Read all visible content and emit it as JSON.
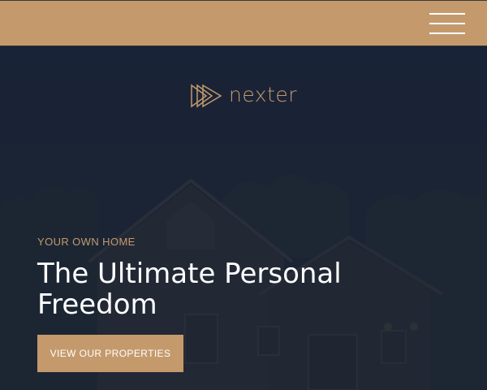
{
  "header": {
    "menu_icon": "hamburger-menu-icon"
  },
  "brand": {
    "logo_icon": "triple-play-triangles-icon",
    "name": "nexter"
  },
  "hero": {
    "eyebrow": "YOUR OWN HOME",
    "headline": "The Ultimate Personal Freedom",
    "cta_label": "VIEW OUR PROPERTIES"
  },
  "colors": {
    "accent": "#c49a6c",
    "overlay": "#1b2434",
    "text": "#ffffff"
  }
}
